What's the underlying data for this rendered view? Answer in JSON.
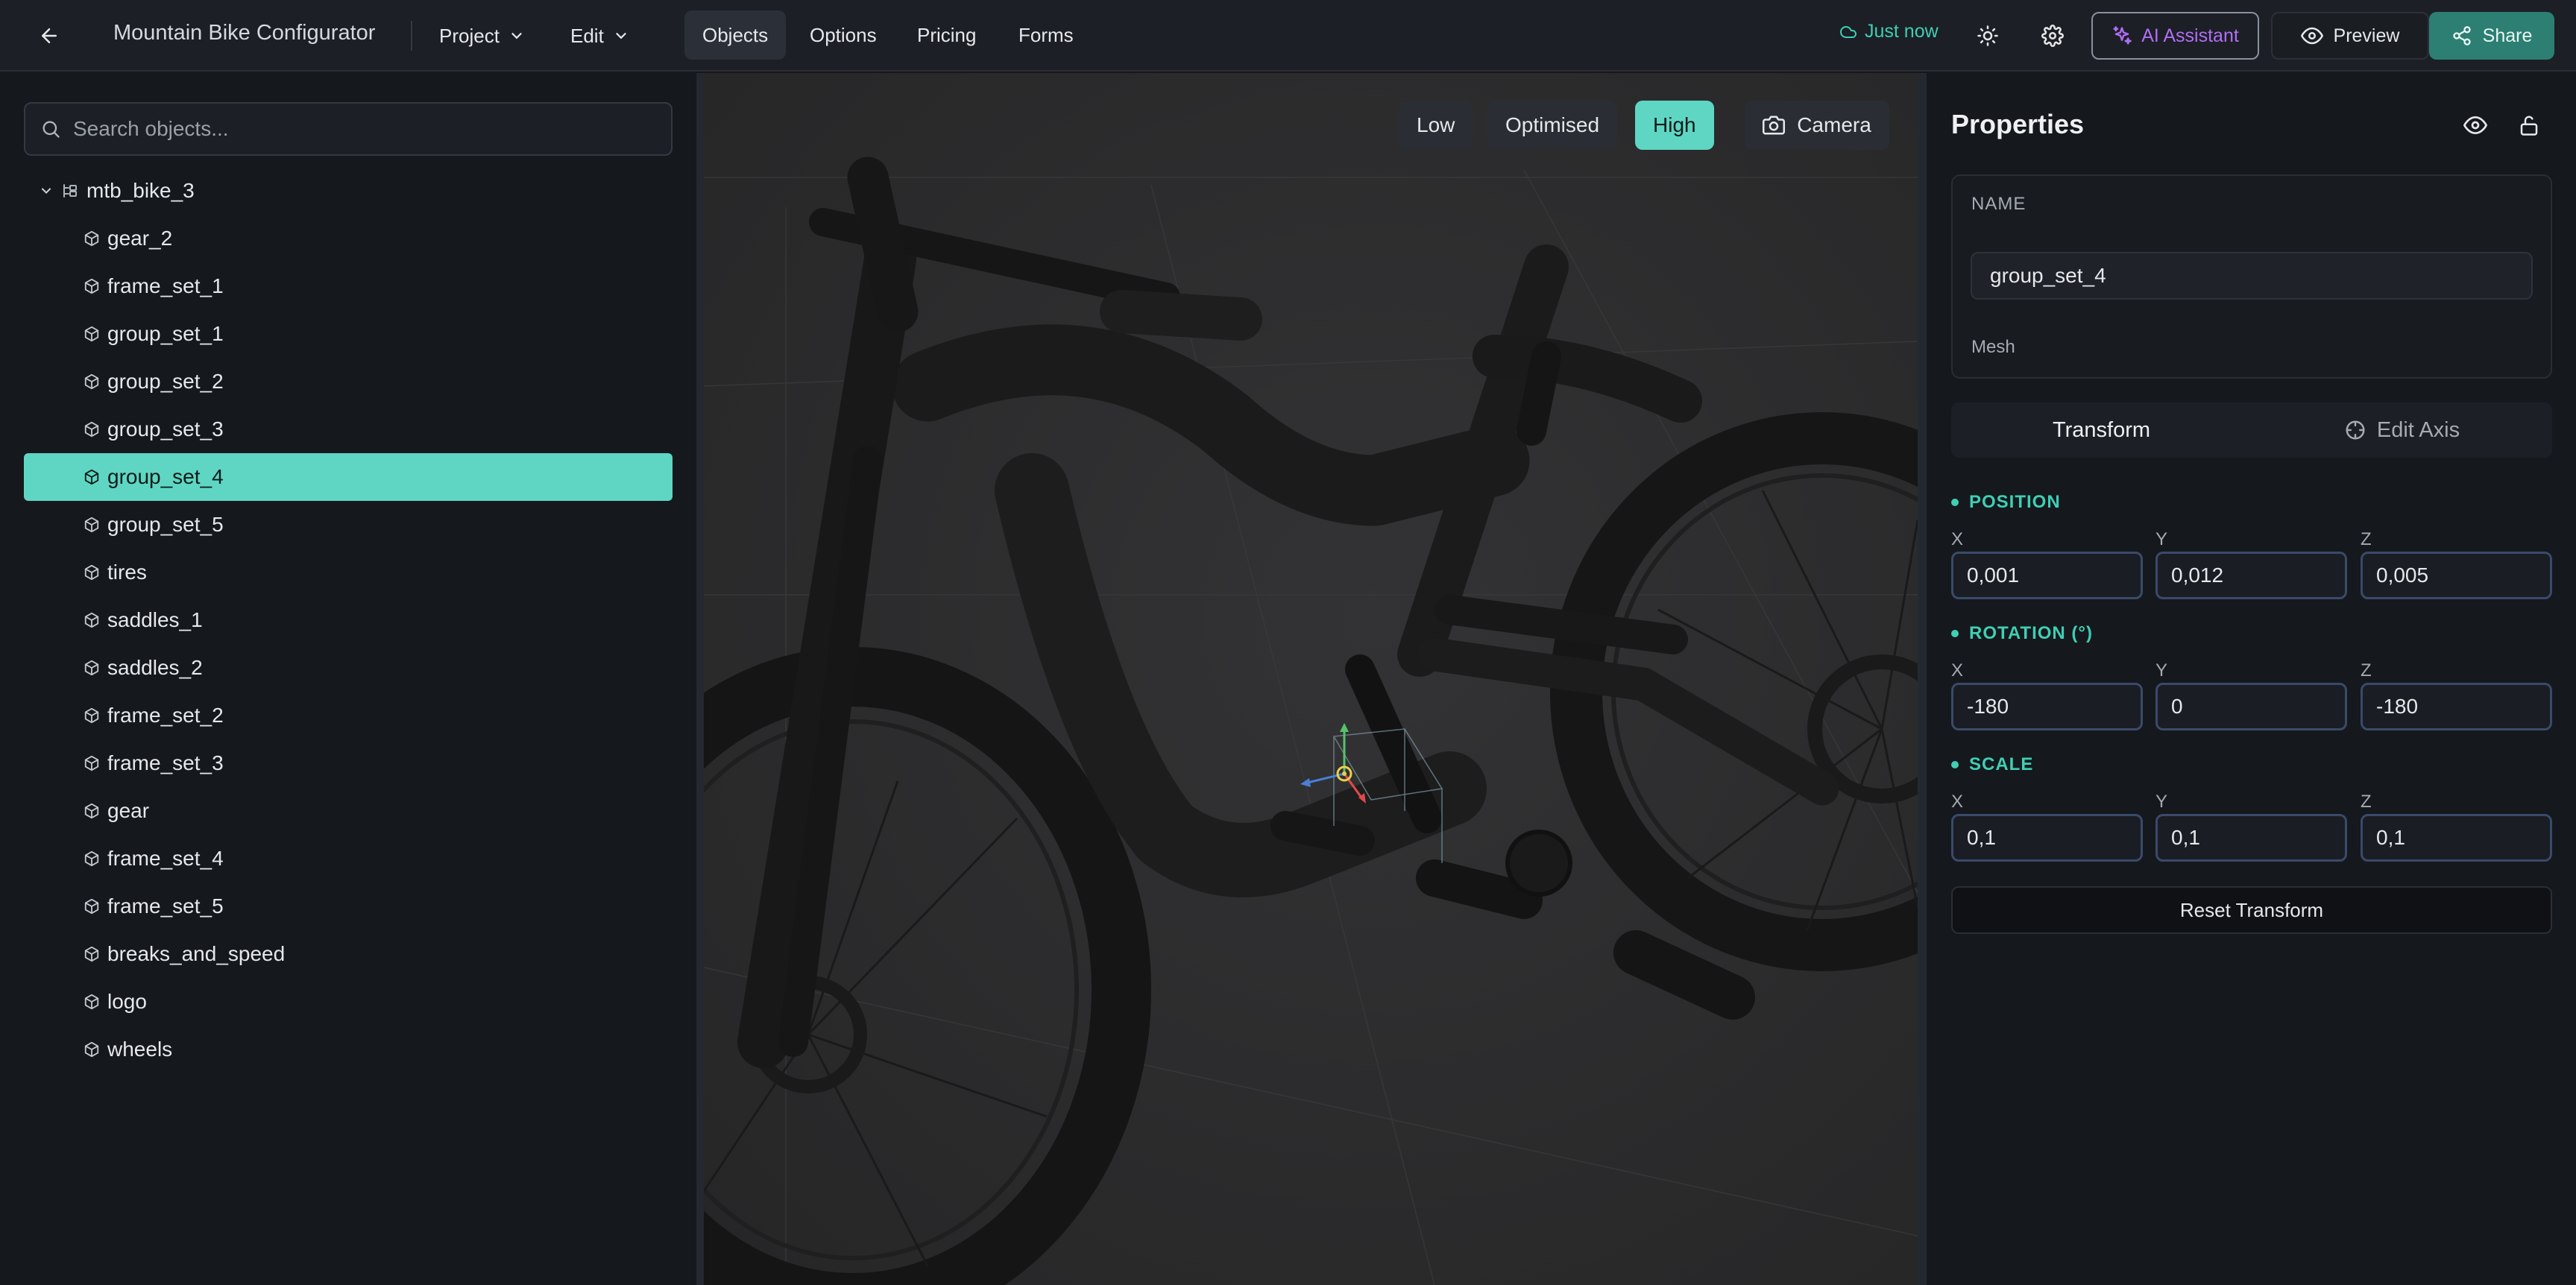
{
  "header": {
    "title": "Mountain Bike Configurator",
    "menus": [
      {
        "label": "Project"
      },
      {
        "label": "Edit"
      }
    ],
    "tabs": [
      {
        "label": "Objects",
        "active": true
      },
      {
        "label": "Options"
      },
      {
        "label": "Pricing"
      },
      {
        "label": "Forms"
      }
    ],
    "save_status": "Just now",
    "ai_label": "AI Assistant",
    "preview_label": "Preview",
    "share_label": "Share",
    "accent": "#5fd6c4",
    "ai_color": "#b06ef5"
  },
  "sidebar": {
    "search_placeholder": "Search objects...",
    "root": "mtb_bike_3",
    "items": [
      {
        "label": "gear_2"
      },
      {
        "label": "frame_set_1"
      },
      {
        "label": "group_set_1"
      },
      {
        "label": "group_set_2"
      },
      {
        "label": "group_set_3"
      },
      {
        "label": "group_set_4",
        "selected": true
      },
      {
        "label": "group_set_5"
      },
      {
        "label": "tires"
      },
      {
        "label": "saddles_1"
      },
      {
        "label": "saddles_2"
      },
      {
        "label": "frame_set_2"
      },
      {
        "label": "frame_set_3"
      },
      {
        "label": "gear"
      },
      {
        "label": "frame_set_4"
      },
      {
        "label": "frame_set_5"
      },
      {
        "label": "breaks_and_speed"
      },
      {
        "label": "logo"
      },
      {
        "label": "wheels"
      }
    ]
  },
  "viewport": {
    "quality": [
      {
        "label": "Low"
      },
      {
        "label": "Optimised"
      },
      {
        "label": "High",
        "active": true
      }
    ],
    "camera_label": "Camera"
  },
  "properties": {
    "title": "Properties",
    "name_label": "NAME",
    "name_value": "group_set_4",
    "type": "Mesh",
    "tabs": {
      "transform": "Transform",
      "edit_axis": "Edit Axis"
    },
    "position": {
      "label": "POSITION",
      "x": "0,001",
      "y": "0,012",
      "z": "0,005"
    },
    "rotation": {
      "label": "ROTATION (°)",
      "x": "-180",
      "y": "0",
      "z": "-180"
    },
    "scale": {
      "label": "SCALE",
      "x": "0,1",
      "y": "0,1",
      "z": "0,1"
    },
    "axis": {
      "x": "X",
      "y": "Y",
      "z": "Z"
    },
    "reset_label": "Reset Transform"
  }
}
